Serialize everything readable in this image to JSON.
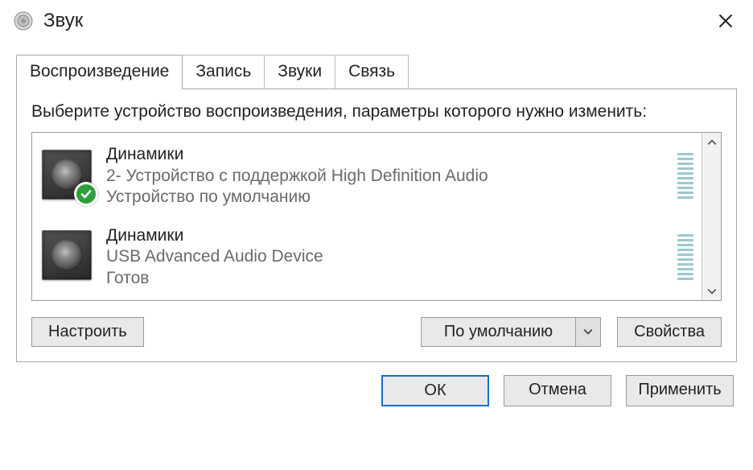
{
  "title": "Звук",
  "tabs": [
    {
      "label": "Воспроизведение",
      "active": true
    },
    {
      "label": "Запись",
      "active": false
    },
    {
      "label": "Звуки",
      "active": false
    },
    {
      "label": "Связь",
      "active": false
    }
  ],
  "instruction": "Выберите устройство воспроизведения, параметры которого нужно изменить:",
  "devices": [
    {
      "name": "Динамики",
      "description": "2- Устройство с поддержкой High Definition Audio",
      "status": "Устройство по умолчанию",
      "is_default": true
    },
    {
      "name": "Динамики",
      "description": "USB Advanced Audio Device",
      "status": "Готов",
      "is_default": false
    }
  ],
  "panel_buttons": {
    "configure": "Настроить",
    "set_default": "По умолчанию",
    "properties": "Свойства"
  },
  "dialog_buttons": {
    "ok": "ОК",
    "cancel": "Отмена",
    "apply": "Применить"
  }
}
